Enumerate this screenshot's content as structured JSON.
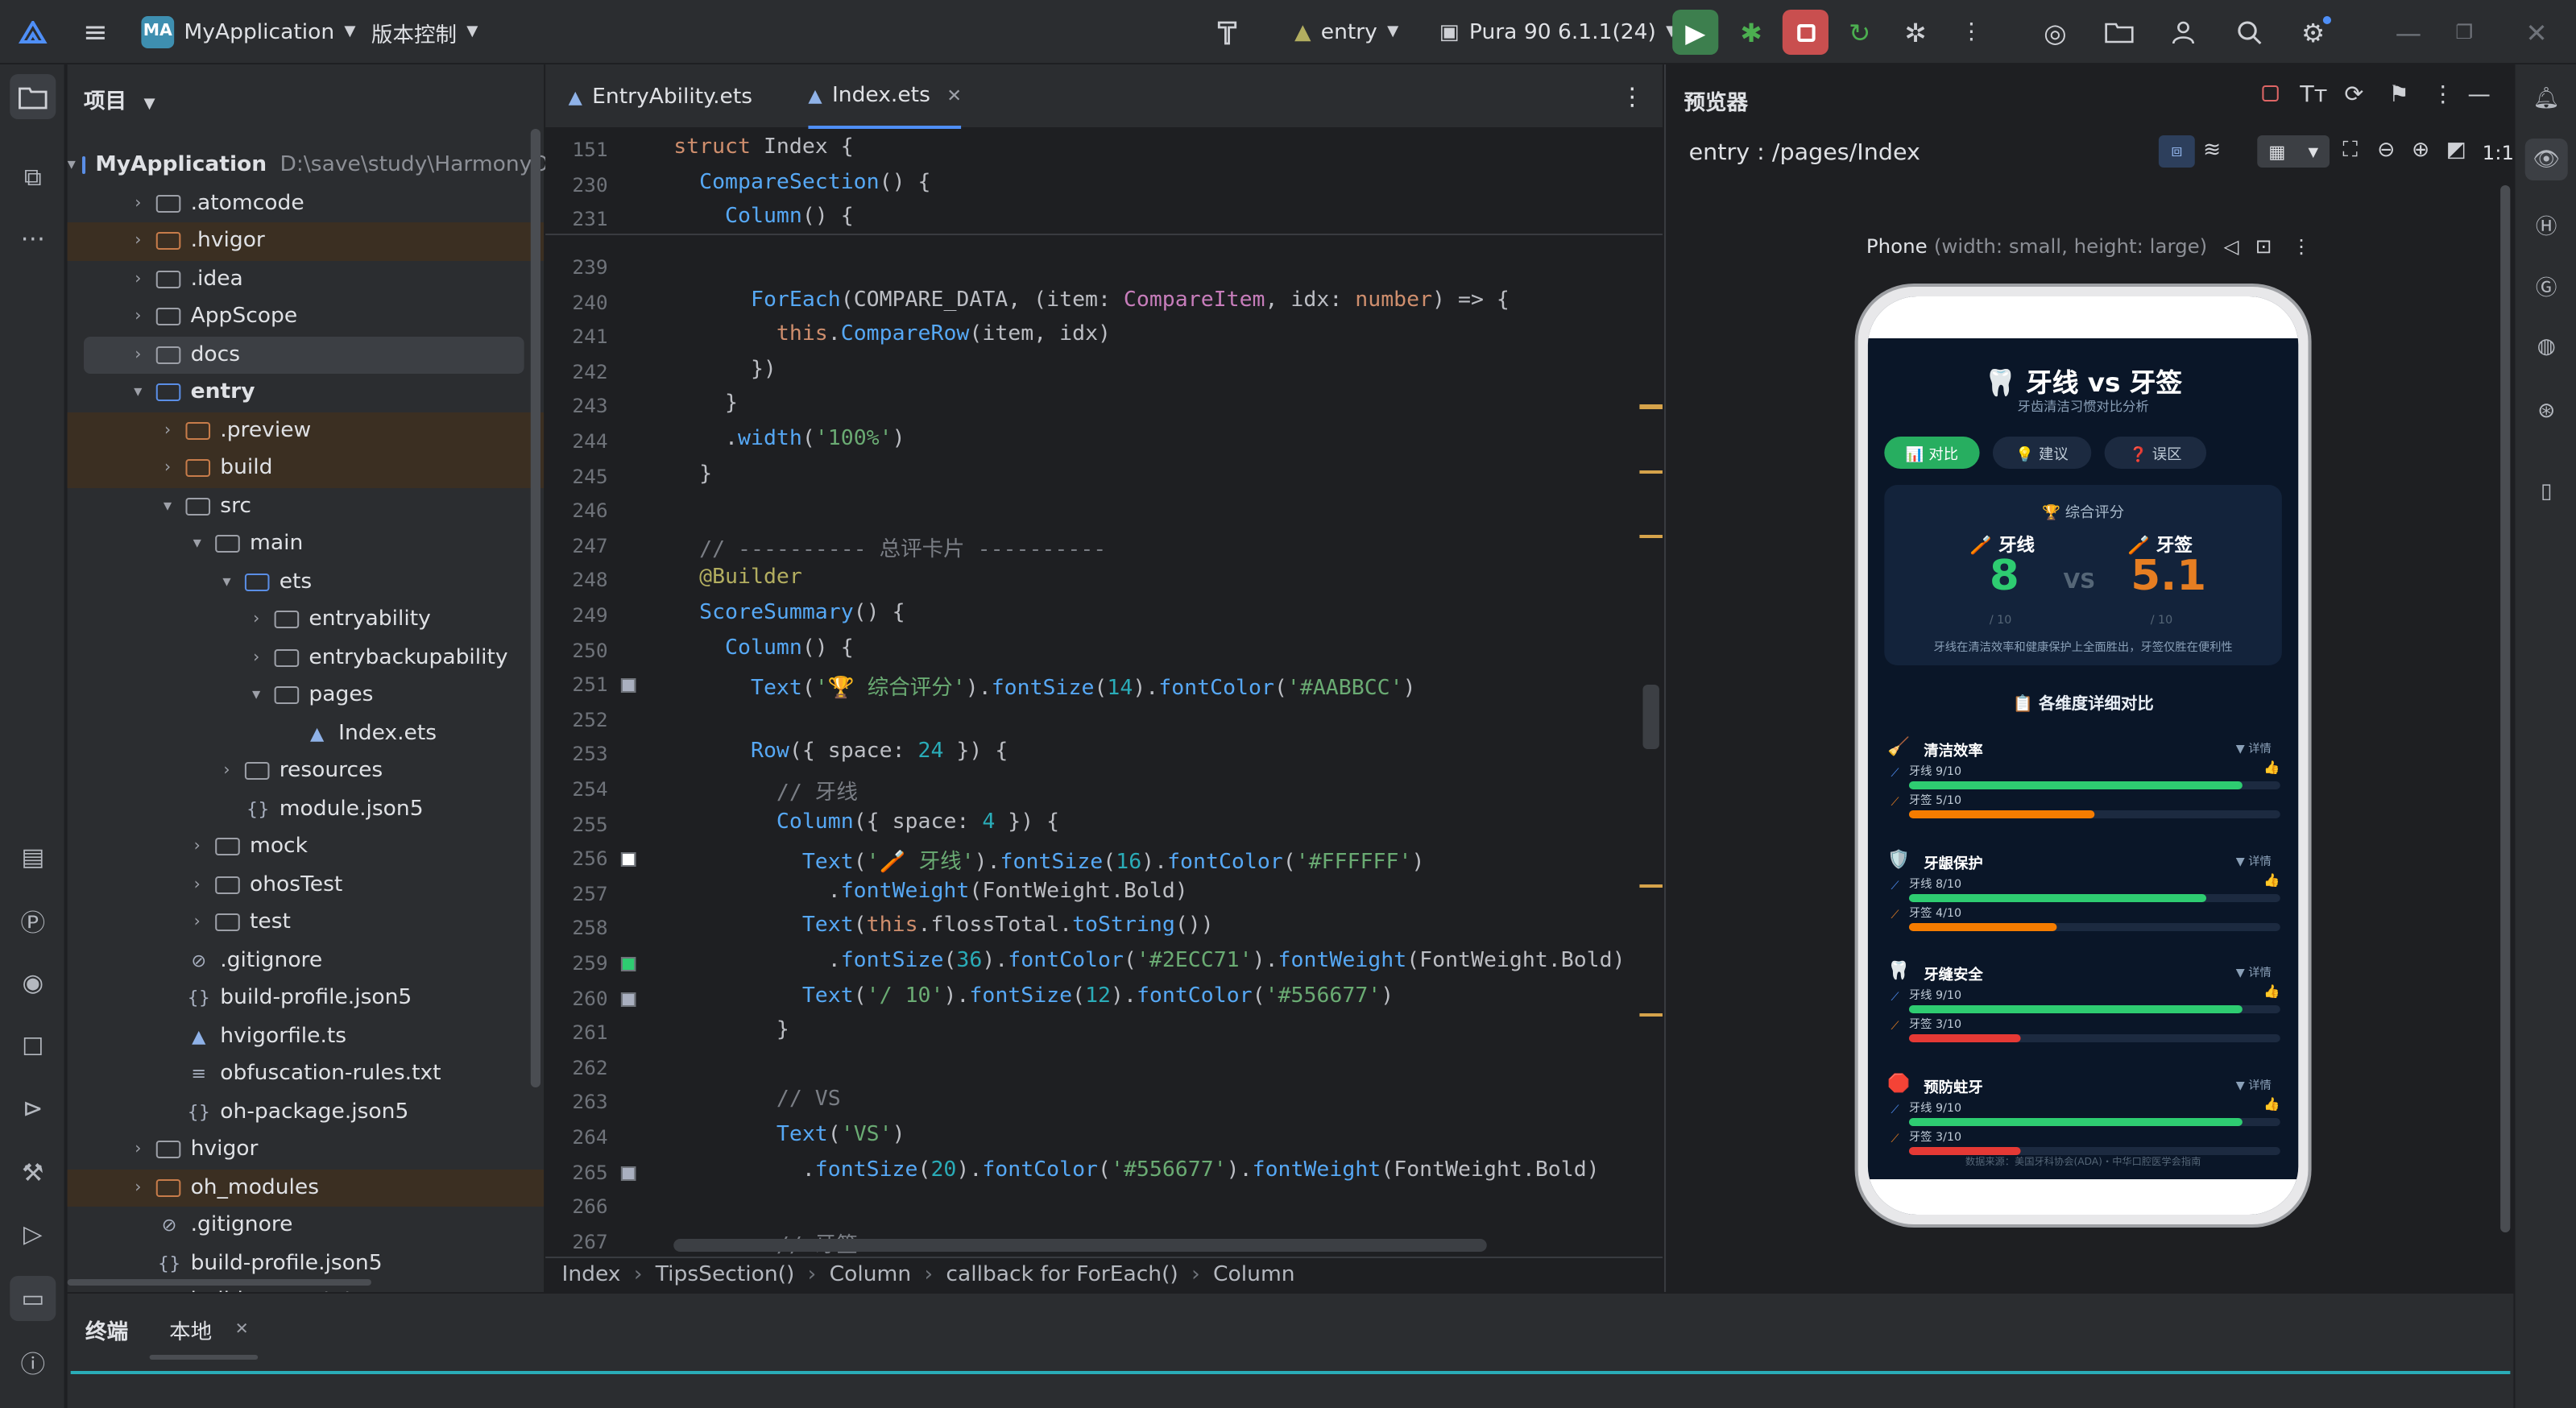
{
  "app": {
    "logo": "MA",
    "project": "MyApplication",
    "vcs": "版本控制",
    "module": "entry",
    "device": "Pura 90 6.1.1(24)"
  },
  "project_panel": {
    "title": "项目",
    "items": [
      {
        "label": "MyApplication",
        "extra": "D:\\save\\study\\HarmonyOS",
        "indent": 0,
        "caret": "▾",
        "icon": "folder-open",
        "bold": true
      },
      {
        "label": ".atomcode",
        "indent": 1,
        "caret": "›",
        "icon": "folder"
      },
      {
        "label": ".hvigor",
        "indent": 1,
        "caret": "›",
        "icon": "folder-orange",
        "hl": true
      },
      {
        "label": ".idea",
        "indent": 1,
        "caret": "›",
        "icon": "folder"
      },
      {
        "label": "AppScope",
        "indent": 1,
        "caret": "›",
        "icon": "folder"
      },
      {
        "label": "docs",
        "indent": 1,
        "caret": "›",
        "icon": "folder",
        "sel": true
      },
      {
        "label": "entry",
        "indent": 1,
        "caret": "▾",
        "icon": "folder-blue",
        "bold": true
      },
      {
        "label": ".preview",
        "indent": 2,
        "caret": "›",
        "icon": "folder-orange",
        "hl": true
      },
      {
        "label": "build",
        "indent": 2,
        "caret": "›",
        "icon": "folder-orange",
        "hl": true
      },
      {
        "label": "src",
        "indent": 2,
        "caret": "▾",
        "icon": "folder"
      },
      {
        "label": "main",
        "indent": 3,
        "caret": "▾",
        "icon": "folder"
      },
      {
        "label": "ets",
        "indent": 4,
        "caret": "▾",
        "icon": "folder-blue"
      },
      {
        "label": "entryability",
        "indent": 5,
        "caret": "›",
        "icon": "folder"
      },
      {
        "label": "entrybackupability",
        "indent": 5,
        "caret": "›",
        "icon": "folder"
      },
      {
        "label": "pages",
        "indent": 5,
        "caret": "▾",
        "icon": "folder"
      },
      {
        "label": "Index.ets",
        "indent": 6,
        "caret": "",
        "icon": "ets"
      },
      {
        "label": "resources",
        "indent": 4,
        "caret": "›",
        "icon": "folder"
      },
      {
        "label": "module.json5",
        "indent": 4,
        "caret": "",
        "icon": "json"
      },
      {
        "label": "mock",
        "indent": 3,
        "caret": "›",
        "icon": "folder"
      },
      {
        "label": "ohosTest",
        "indent": 3,
        "caret": "›",
        "icon": "folder"
      },
      {
        "label": "test",
        "indent": 3,
        "caret": "›",
        "icon": "folder"
      },
      {
        "label": ".gitignore",
        "indent": 2,
        "caret": "",
        "icon": "ignore"
      },
      {
        "label": "build-profile.json5",
        "indent": 2,
        "caret": "",
        "icon": "json"
      },
      {
        "label": "hvigorfile.ts",
        "indent": 2,
        "caret": "",
        "icon": "ets"
      },
      {
        "label": "obfuscation-rules.txt",
        "indent": 2,
        "caret": "",
        "icon": "txt"
      },
      {
        "label": "oh-package.json5",
        "indent": 2,
        "caret": "",
        "icon": "json"
      },
      {
        "label": "hvigor",
        "indent": 1,
        "caret": "›",
        "icon": "folder"
      },
      {
        "label": "oh_modules",
        "indent": 1,
        "caret": "›",
        "icon": "folder-orange",
        "hl": true
      },
      {
        "label": ".gitignore",
        "indent": 1,
        "caret": "",
        "icon": "ignore"
      },
      {
        "label": "build-profile.json5",
        "indent": 1,
        "caret": "",
        "icon": "json"
      },
      {
        "label": "build_errors.txt",
        "indent": 1,
        "caret": "",
        "icon": "txt"
      }
    ]
  },
  "editor": {
    "tabs": [
      "EntryAbility.ets",
      "Index.ets"
    ],
    "warnings": "5",
    "sticky": [
      {
        "ln": "151",
        "html": "<span class='kw'>struct</span> <span class='pl'>Index</span> {"
      },
      {
        "ln": "230",
        "html": "  <span class='fn'>CompareSection</span>() {"
      },
      {
        "ln": "231",
        "html": "    <span class='fn'>Column</span>() {"
      }
    ],
    "lines": [
      {
        "ln": "239",
        "html": ""
      },
      {
        "ln": "240",
        "html": "      <span class='fn'>ForEach</span>(COMPARE_DATA, (item: <span class='ty'>CompareItem</span>, idx: <span class='kw'>number</span>) => {"
      },
      {
        "ln": "241",
        "html": "        <span class='kw'>this</span>.<span class='fn'>CompareRow</span>(item, idx)"
      },
      {
        "ln": "242",
        "html": "      })"
      },
      {
        "ln": "243",
        "html": "    }"
      },
      {
        "ln": "244",
        "html": "    .<span class='fn'>width</span>(<span class='str'>'100%'</span>)"
      },
      {
        "ln": "245",
        "html": "  }"
      },
      {
        "ln": "246",
        "html": ""
      },
      {
        "ln": "247",
        "html": "  <span class='cm'>// ---------- 总评卡片 ----------</span>"
      },
      {
        "ln": "248",
        "html": "  <span class='an'>@Builder</span>"
      },
      {
        "ln": "249",
        "html": "  <span class='fn'>ScoreSummary</span>() {"
      },
      {
        "ln": "250",
        "html": "    <span class='fn'>Column</span>() {"
      },
      {
        "ln": "251",
        "html": "      <span class='fn'>Text</span>(<span class='str'>'🏆 综合评分'</span>).<span class='fn'>fontSize</span>(<span class='num'>14</span>).<span class='fn'>fontColor</span>(<span class='str'>'#AABBCC'</span>)"
      },
      {
        "ln": "252",
        "html": ""
      },
      {
        "ln": "253",
        "html": "      <span class='fn'>Row</span>({ space: <span class='num'>24</span> }) {"
      },
      {
        "ln": "254",
        "html": "        <span class='cm'>// 牙线</span>"
      },
      {
        "ln": "255",
        "html": "        <span class='fn'>Column</span>({ space: <span class='num'>4</span> }) {"
      },
      {
        "ln": "256",
        "html": "          <span class='fn'>Text</span>(<span class='str'>'🪥 牙线'</span>).<span class='fn'>fontSize</span>(<span class='num'>16</span>).<span class='fn'>fontColor</span>(<span class='str'>'#FFFFFF'</span>)"
      },
      {
        "ln": "257",
        "html": "            .<span class='fn'>fontWeight</span>(FontWeight.Bold)"
      },
      {
        "ln": "258",
        "html": "          <span class='fn'>Text</span>(<span class='kw'>this</span>.flossTotal.<span class='fn'>toString</span>())"
      },
      {
        "ln": "259",
        "html": "            .<span class='fn'>fontSize</span>(<span class='num'>36</span>).<span class='fn'>fontColor</span>(<span class='str'>'#2ECC71'</span>).<span class='fn'>fontWeight</span>(FontWeight.Bold)"
      },
      {
        "ln": "260",
        "html": "          <span class='fn'>Text</span>(<span class='str'>'/ 10'</span>).<span class='fn'>fontSize</span>(<span class='num'>12</span>).<span class='fn'>fontColor</span>(<span class='str'>'#556677'</span>)"
      },
      {
        "ln": "261",
        "html": "        }"
      },
      {
        "ln": "262",
        "html": ""
      },
      {
        "ln": "263",
        "html": "        <span class='cm'>// VS</span>"
      },
      {
        "ln": "264",
        "html": "        <span class='fn'>Text</span>(<span class='str'>'VS'</span>)"
      },
      {
        "ln": "265",
        "html": "          .<span class='fn'>fontSize</span>(<span class='num'>20</span>).<span class='fn'>fontColor</span>(<span class='str'>'#556677'</span>).<span class='fn'>fontWeight</span>(FontWeight.Bold)"
      },
      {
        "ln": "266",
        "html": ""
      },
      {
        "ln": "267",
        "html": "        <span class='cm'>// 牙签</span>"
      }
    ],
    "breadcrumb": [
      "Index",
      "TipsSection()",
      "Column",
      "callback for ForEach()",
      "Column"
    ]
  },
  "previewer": {
    "title": "预览器",
    "route": "entry : /pages/Index",
    "device_label": "Phone",
    "device_desc": "(width: small, height: large)",
    "zoom_label": "1:1"
  },
  "app_screen": {
    "title": "🦷 牙线 vs 牙签",
    "subtitle": "牙齿清洁习惯对比分析",
    "tabs": [
      "📊 对比",
      "💡 建议",
      "❓ 误区"
    ],
    "summary_title": "🏆 综合评分",
    "floss_label": "🪥 牙线",
    "pick_label": "🪥 牙签",
    "floss_score": "8",
    "pick_score": "5.1",
    "vs": "VS",
    "out_of": "/ 10",
    "summary_note": "牙线在清洁效率和健康保护上全面胜出，牙签仅胜在便利性",
    "detail_title": "📋 各维度详细对比",
    "detail_link": "▼ 详情",
    "source": "数据来源：美国牙科协会(ADA)・中华口腔医学会指南",
    "colors": {
      "floss": "#2ECC71",
      "pick_orange": "#F57C00",
      "pick_red": "#E53935",
      "bg": "#0A1628"
    },
    "rows": [
      {
        "icon": "🧹",
        "name": "清洁效率",
        "floss_label": "牙线 9/10",
        "pick_label": "牙签 5/10",
        "floss": 0.9,
        "pick": 0.5,
        "pick_color": "orange"
      },
      {
        "icon": "🛡️",
        "name": "牙龈保护",
        "floss_label": "牙线 8/10",
        "pick_label": "牙签 4/10",
        "floss": 0.8,
        "pick": 0.4,
        "pick_color": "orange"
      },
      {
        "icon": "🦷",
        "name": "牙缝安全",
        "floss_label": "牙线 9/10",
        "pick_label": "牙签 3/10",
        "floss": 0.9,
        "pick": 0.3,
        "pick_color": "red"
      },
      {
        "icon": "🛑",
        "name": "预防蛀牙",
        "floss_label": "牙线 9/10",
        "pick_label": "牙签 3/10",
        "floss": 0.9,
        "pick": 0.3,
        "pick_color": "red"
      }
    ]
  },
  "bottom_panel": {
    "tabs": [
      "终端",
      "本地"
    ]
  }
}
